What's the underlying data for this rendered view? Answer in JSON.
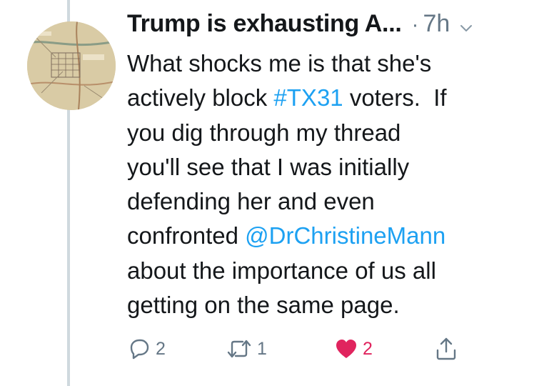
{
  "tweet": {
    "display_name": "Trump is exhausting A...",
    "separator": "·",
    "timestamp": "7h",
    "text": {
      "line1": "What shocks me is that she's",
      "line2_a": "actively block ",
      "hashtag": "#TX31",
      "line2_b": " voters.  If",
      "line3": "you dig through my thread",
      "line4": "you'll see that I was initially",
      "line5": "defending her and even",
      "line6_a": "confronted ",
      "mention": "@DrChristineMann",
      "line7": "about the importance of us all",
      "line8": "getting on the same page."
    },
    "actions": {
      "reply_count": "2",
      "retweet_count": "1",
      "like_count": "2"
    }
  },
  "colors": {
    "link": "#1da1f2",
    "like": "#e0245e",
    "muted": "#657786",
    "thread_line": "#cfd9de"
  },
  "icons": {
    "reply": "reply-icon",
    "retweet": "retweet-icon",
    "like": "heart-icon",
    "share": "share-icon",
    "caret": "chevron-down-icon"
  }
}
